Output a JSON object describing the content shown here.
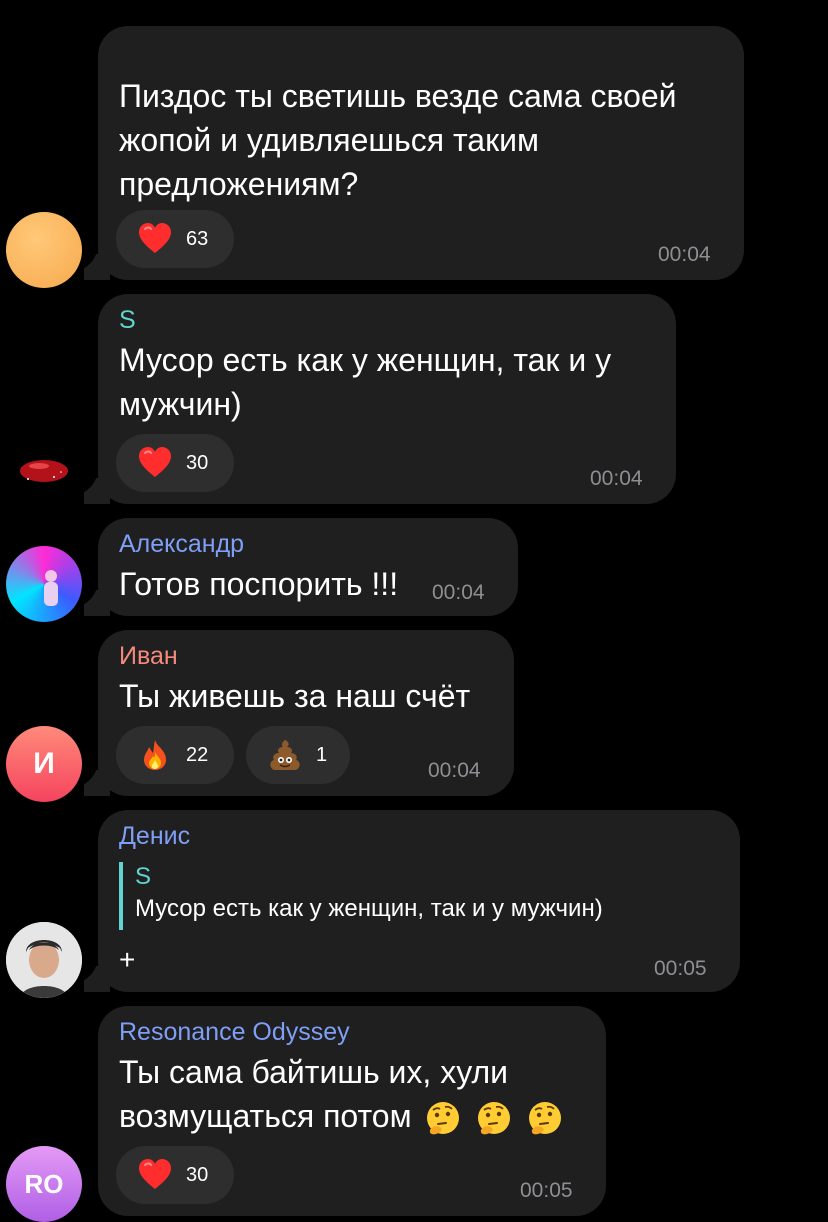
{
  "messages": [
    {
      "sender": "",
      "text_lines": [
        "Пиздос ты светишь везде сама своей",
        "жопой и удивляешься таким",
        "предложениям?"
      ],
      "reactions": [
        {
          "emoji": "red-heart",
          "count": "63"
        }
      ],
      "time": "00:04"
    },
    {
      "sender": "S",
      "text_lines": [
        "Мусор есть как у женщин, так и у",
        "мужчин)"
      ],
      "reactions": [
        {
          "emoji": "red-heart",
          "count": "30"
        }
      ],
      "time": "00:04"
    },
    {
      "sender": "Александр",
      "text_lines": [
        "Готов поспорить !!!"
      ],
      "time": "00:04"
    },
    {
      "sender": "Иван",
      "avatar_letter": "И",
      "text_lines": [
        "Ты живешь за наш счёт"
      ],
      "reactions": [
        {
          "emoji": "fire",
          "count": "22"
        },
        {
          "emoji": "pile-of-poo",
          "count": "1"
        }
      ],
      "time": "00:04"
    },
    {
      "sender": "Денис",
      "reply": {
        "sender": "S",
        "text": "Мусор есть как у женщин, так и у мужчин)"
      },
      "text_lines": [
        "+"
      ],
      "time": "00:05"
    },
    {
      "sender": "Resonance Odyssey",
      "avatar_letters": "RO",
      "text_lines": [
        "Ты сама байтишь их, хули",
        "возмущаться потом"
      ],
      "inline_emoji": [
        "thinking-face",
        "thinking-face",
        "thinking-face"
      ],
      "reactions": [
        {
          "emoji": "red-heart",
          "count": "30"
        }
      ],
      "time": "00:05"
    }
  ],
  "colors": {
    "background": "#000000",
    "bubble": "#1f1f1f",
    "reaction_pill": "#2e2e2e",
    "time": "#8e8e93",
    "sender_s": "#5fd4d0",
    "sender_aleksandr": "#7f9ef5",
    "sender_ivan": "#f48a7e",
    "sender_denis": "#7f9ef5",
    "sender_ro": "#7f9ef5"
  }
}
